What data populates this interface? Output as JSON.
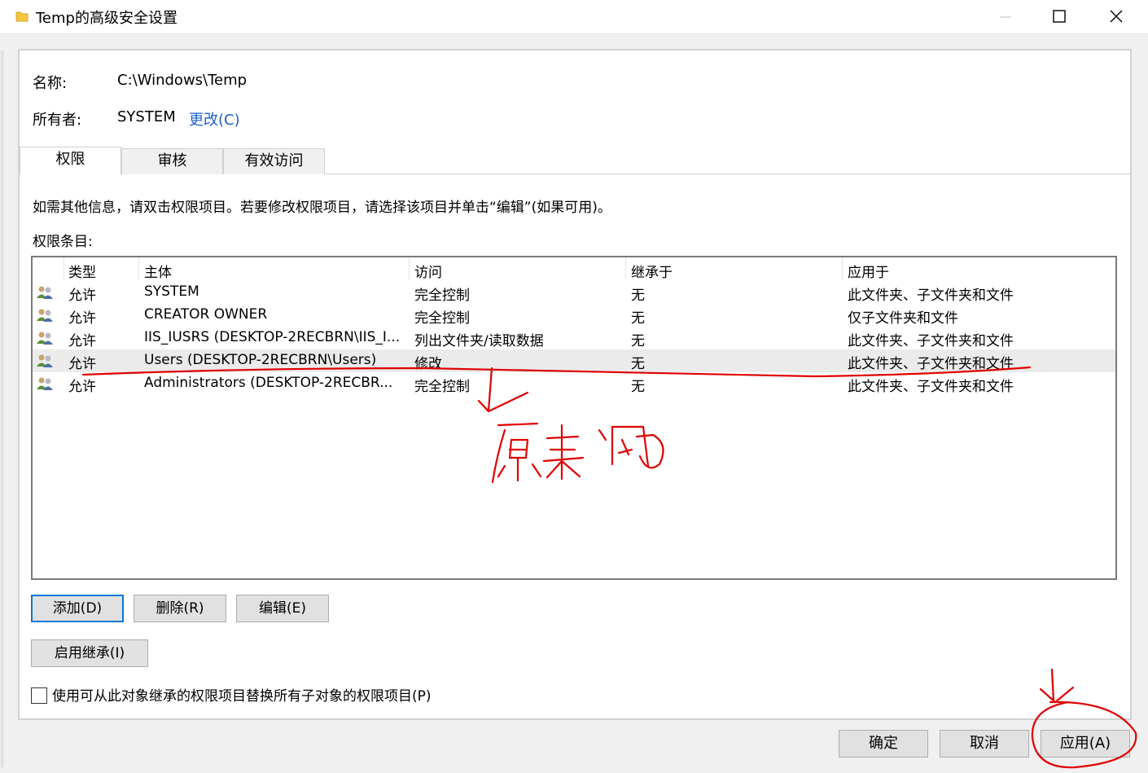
{
  "window": {
    "title": "Temp的高级安全设置"
  },
  "fields": {
    "name_label": "名称:",
    "name_value": "C:\\Windows\\Temp",
    "owner_label": "所有者:",
    "owner_value": "SYSTEM",
    "change_link": "更改(C)"
  },
  "tabs": [
    {
      "label": "权限",
      "active": true
    },
    {
      "label": "审核",
      "active": false
    },
    {
      "label": "有效访问",
      "active": false
    }
  ],
  "info_text": "如需其他信息，请双击权限项目。若要修改权限项目，请选择该项目并单击“编辑”(如果可用)。",
  "list_label": "权限条目:",
  "columns": [
    "类型",
    "主体",
    "访问",
    "继承于",
    "应用于"
  ],
  "rows": [
    {
      "type": "允许",
      "principal": "SYSTEM",
      "access": "完全控制",
      "inherited": "无",
      "applies": "此文件夹、子文件夹和文件"
    },
    {
      "type": "允许",
      "principal": "CREATOR OWNER",
      "access": "完全控制",
      "inherited": "无",
      "applies": "仅子文件夹和文件"
    },
    {
      "type": "允许",
      "principal": "IIS_IUSRS (DESKTOP-2RECBRN\\IIS_I...",
      "access": "列出文件夹/读取数据",
      "inherited": "无",
      "applies": "此文件夹、子文件夹和文件"
    },
    {
      "type": "允许",
      "principal": "Users (DESKTOP-2RECBRN\\Users)",
      "access": "修改",
      "inherited": "无",
      "applies": "此文件夹、子文件夹和文件"
    },
    {
      "type": "允许",
      "principal": "Administrators (DESKTOP-2RECBR...",
      "access": "完全控制",
      "inherited": "无",
      "applies": "此文件夹、子文件夹和文件"
    }
  ],
  "buttons": {
    "add": "添加(D)",
    "remove": "删除(R)",
    "edit": "编辑(E)",
    "enable_inheritance": "启用继承(I)",
    "ok": "确定",
    "cancel": "取消",
    "apply": "应用(A)"
  },
  "checkbox_label": "使用可从此对象继承的权限项目替换所有子对象的权限项目(P)",
  "colors": {
    "link": "#1e5fc9",
    "annotation": "#e00000",
    "focus": "#0078d7"
  }
}
